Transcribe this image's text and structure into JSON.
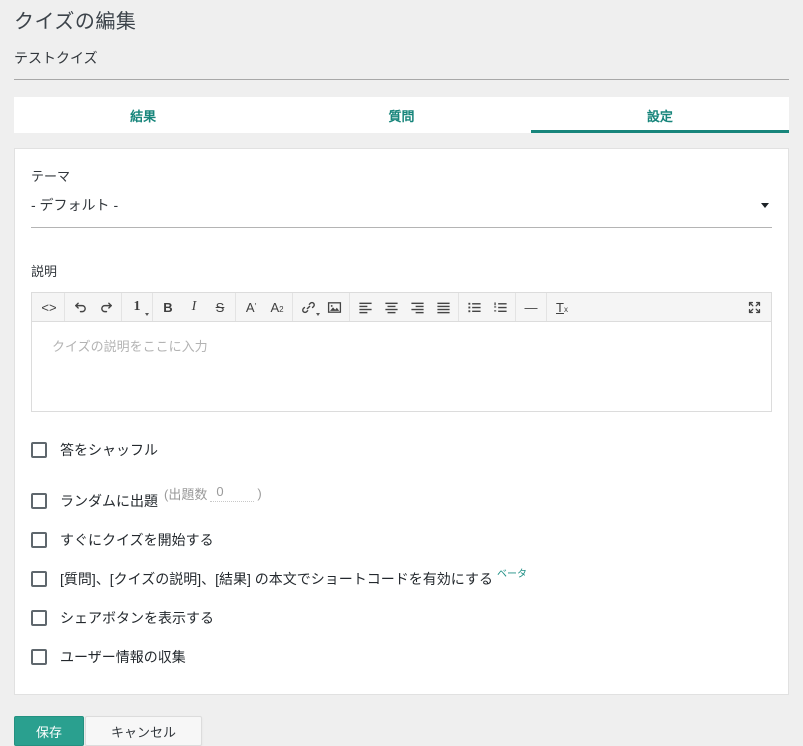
{
  "page": {
    "title": "クイズの編集"
  },
  "quiz_title": {
    "value": "テストクイズ"
  },
  "tabs": [
    {
      "label": "結果",
      "active": false
    },
    {
      "label": "質問",
      "active": false
    },
    {
      "label": "設定",
      "active": true
    }
  ],
  "theme": {
    "label": "テーマ",
    "value": "- デフォルト -"
  },
  "description": {
    "label": "説明",
    "placeholder": "クイズの説明をここに入力"
  },
  "toolbar": {
    "glyphs": {
      "code": "<>",
      "paragraph": "1",
      "bold": "B",
      "italic": "I",
      "strike": "S",
      "sup_base": "A",
      "sup_mark": "′",
      "sub_base": "A",
      "sub_mark": "2",
      "hr": "—",
      "clear_base": "T",
      "clear_sub": "x"
    },
    "icon_names": [
      "code-view",
      "undo",
      "redo",
      "paragraph-format",
      "bold",
      "italic",
      "strikethrough",
      "superscript",
      "subscript",
      "insert-link",
      "insert-image",
      "align-left",
      "align-center",
      "align-right",
      "align-justify",
      "unordered-list",
      "ordered-list",
      "horizontal-line",
      "clear-formatting",
      "fullscreen"
    ]
  },
  "options": {
    "shuffle": "答をシャッフル",
    "random": "ランダムに出題",
    "count_prefix": "(出題数",
    "count_value": "0",
    "count_suffix": ")",
    "start_now": "すぐにクイズを開始する",
    "shortcode": "[質問]、[クイズの説明]、[結果] の本文でショートコードを有効にする",
    "shortcode_beta": "ベータ",
    "share": "シェアボタンを表示する",
    "collect": "ユーザー情報の収集"
  },
  "footer": {
    "save": "保存",
    "cancel": "キャンセル"
  },
  "colors": {
    "accent": "#17857b",
    "save_bg": "#2aa08f",
    "background": "#efefef"
  }
}
